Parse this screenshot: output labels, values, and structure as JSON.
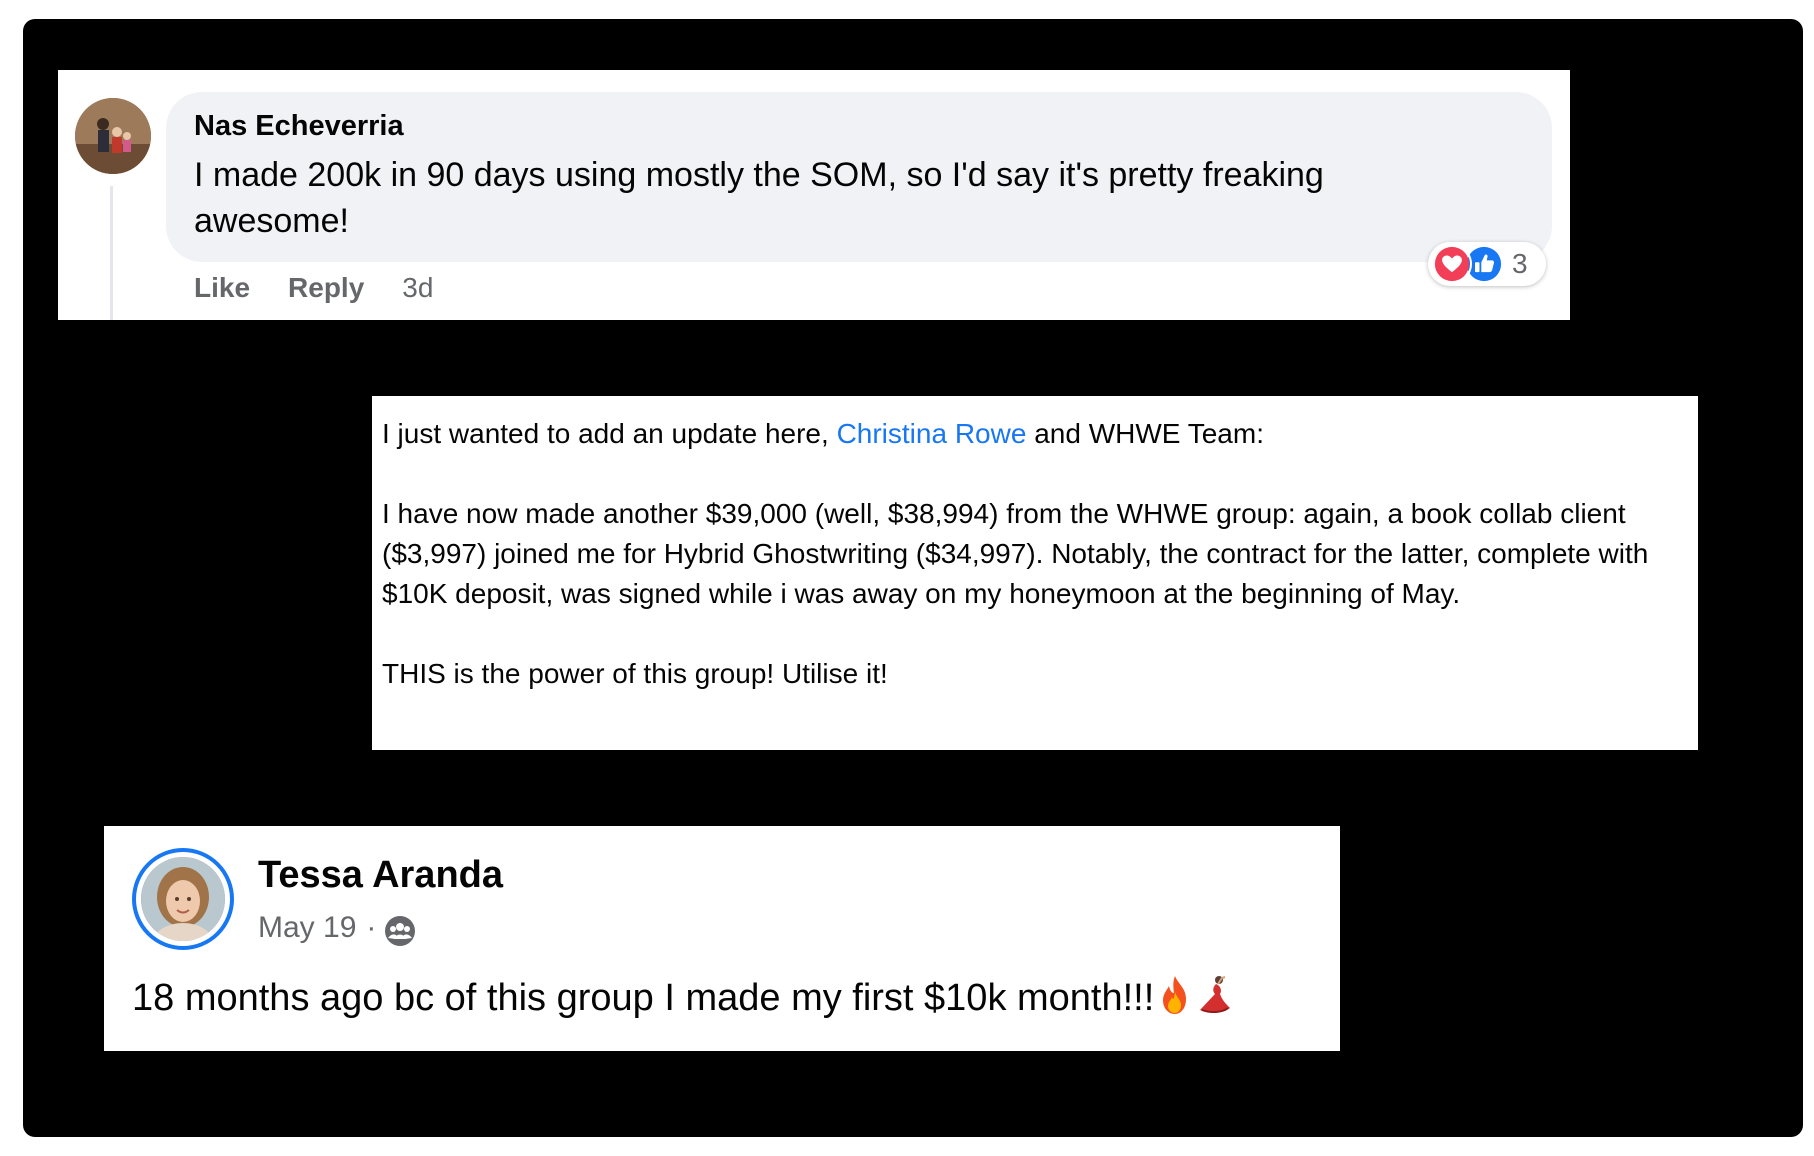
{
  "comment": {
    "author": "Nas Echeverria",
    "text": "I made 200k in 90 days using mostly the SOM, so I'd say it's pretty freaking awesome!",
    "actions": {
      "like": "Like",
      "reply": "Reply",
      "time": "3d"
    },
    "reactions": {
      "icons": [
        "heart-icon",
        "like-icon"
      ],
      "count": "3"
    }
  },
  "update": {
    "intro_before": "I just wanted to add an update here, ",
    "mention": "Christina Rowe",
    "intro_after": " and WHWE Team:",
    "body": "I have now made another $39,000 (well, $38,994) from the WHWE group: again, a book collab client ($3,997) joined me for Hybrid Ghostwriting ($34,997). Notably, the contract for the latter, complete with $10K deposit, was signed while i was away on my honeymoon at the beginning of May.",
    "closing": "THIS is the power of this group! Utilise it!"
  },
  "post": {
    "author": "Tessa Aranda",
    "date": "May 19",
    "separator": "·",
    "audience_icon": "group-icon",
    "text": "18 months ago bc of this group I made my first $10k month!!!",
    "emojis": [
      "fire-emoji",
      "dancer-emoji"
    ]
  },
  "colors": {
    "background": "#000000",
    "card": "#ffffff",
    "bubble": "#f0f2f5",
    "link": "#1877f2",
    "secondary_text": "#65676b",
    "primary_text": "#050505"
  }
}
